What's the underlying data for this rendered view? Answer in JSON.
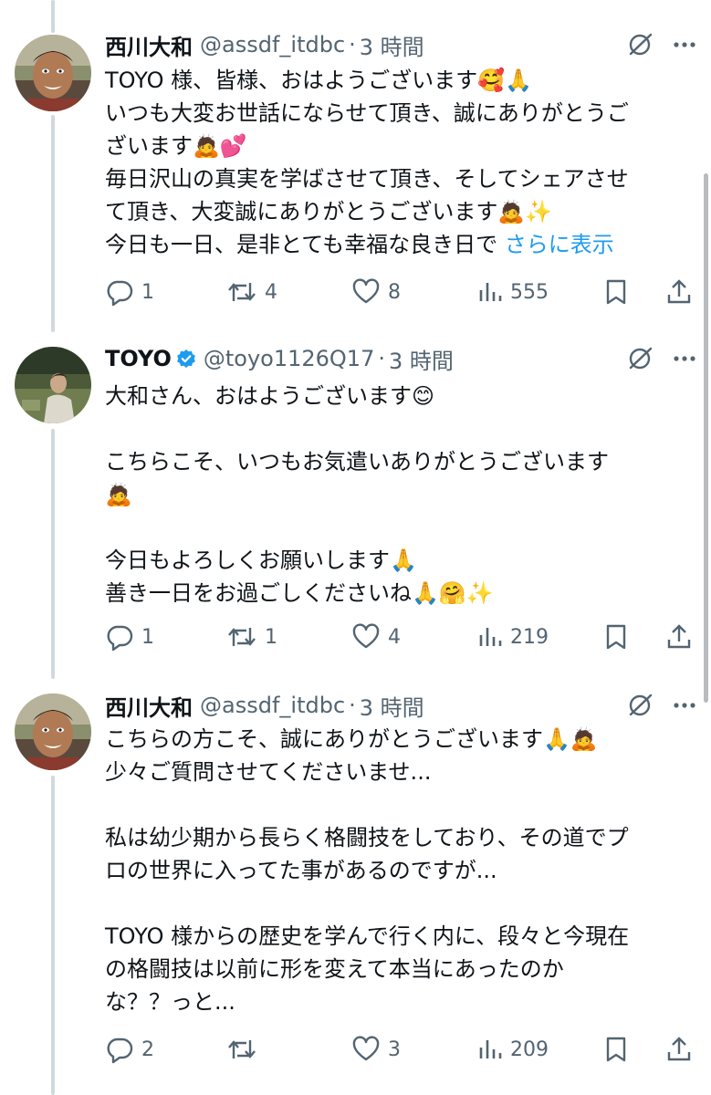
{
  "tweets": [
    {
      "name": "西川大和",
      "handle": "@assdf_itdbc",
      "time": "3 時間",
      "verified": false,
      "lines": [
        "TOYO 様、皆様、おはようございます🥰🙏",
        "いつも大変お世話にならせて頂き、誠にありがとうご",
        "ざいます🙇💕",
        "毎日沢山の真実を学ばさせて頂き、そしてシェアさせ",
        "て頂き、大変誠にありがとうございます🙇✨",
        "今日も一日、是非とても幸福な良き日で "
      ],
      "show_more": "さらに表示",
      "replies": "1",
      "reposts": "4",
      "likes": "8",
      "views": "555"
    },
    {
      "name": "TOYO",
      "handle": "@toyo1126Q17",
      "time": "3 時間",
      "verified": true,
      "lines": [
        "大和さん、おはようございます😊",
        "",
        "こちらこそ、いつもお気遣いありがとうございます",
        "🙇",
        "",
        "今日もよろしくお願いします🙏",
        "善き一日をお過ごしくださいね🙏🤗✨"
      ],
      "replies": "1",
      "reposts": "1",
      "likes": "4",
      "views": "219"
    },
    {
      "name": "西川大和",
      "handle": "@assdf_itdbc",
      "time": "3 時間",
      "verified": false,
      "lines": [
        "こちらの方こそ、誠にありがとうございます🙏🙇",
        "少々ご質問させてくださいませ...",
        "",
        "私は幼少期から長らく格闘技をしており、その道でプ",
        "ロの世界に入ってた事があるのですが...",
        "",
        "TOYO 様からの歴史を学んで行く内に、段々と今現在",
        "の格闘技は以前に形を変えて本当にあったのか",
        "な？？っと..."
      ],
      "replies": "2",
      "reposts": "",
      "likes": "3",
      "views": "209"
    }
  ],
  "colors": {
    "text": "#0f1419",
    "secondary": "#536471",
    "link": "#1d9bf0",
    "verified": "#1d9bf0",
    "thread_line": "#cfd9de"
  },
  "icons": [
    "reply-icon",
    "repost-icon",
    "like-icon",
    "views-icon",
    "bookmark-icon",
    "share-icon",
    "grok-icon",
    "more-icon",
    "verified-badge-icon"
  ]
}
